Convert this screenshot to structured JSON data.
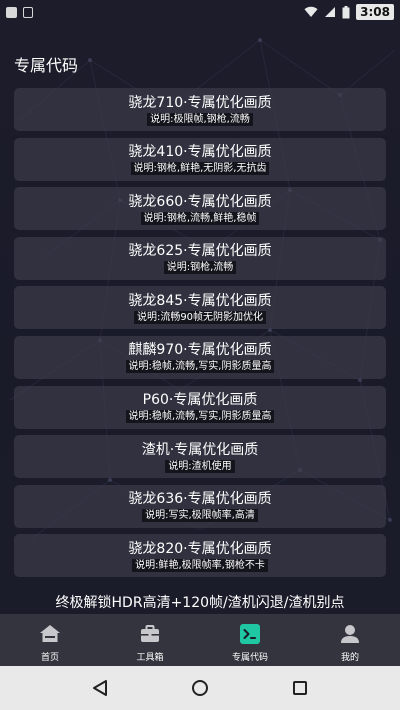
{
  "status_bar": {
    "time": "3:08",
    "icons": [
      "app-notification-icon",
      "sim-notification-icon",
      "wifi-icon",
      "signal-icon",
      "battery-icon"
    ]
  },
  "header": {
    "title": "专属代码"
  },
  "items": [
    {
      "title": "骁龙710·专属优化画质",
      "desc": "说明:极限帧,钢枪,流畅"
    },
    {
      "title": "骁龙410·专属优化画质",
      "desc": "说明:钢枪,鲜艳,无阴影,无抗齿"
    },
    {
      "title": "骁龙660·专属优化画质",
      "desc": "说明:钢枪,流畅,鲜艳,稳帧"
    },
    {
      "title": "骁龙625·专属优化画质",
      "desc": "说明:钢枪,流畅"
    },
    {
      "title": "骁龙845·专属优化画质",
      "desc": "说明:流畅90帧无阴影加优化"
    },
    {
      "title": "麒麟970·专属优化画质",
      "desc": "说明:稳帧,流畅,写实,阴影质量高"
    },
    {
      "title": "P60·专属优化画质",
      "desc": "说明:稳帧,流畅,写实,阴影质量高"
    },
    {
      "title": "渣机·专属优化画质",
      "desc": "说明:渣机使用"
    },
    {
      "title": "骁龙636·专属优化画质",
      "desc": "说明:写实,极限帧率,高清"
    },
    {
      "title": "骁龙820·专属优化画质",
      "desc": "说明:鲜艳,极限帧率,钢枪不卡"
    }
  ],
  "banner": {
    "title": "终极解锁HDR高清+120帧/渣机闪退/渣机别点"
  },
  "bottom_nav": [
    {
      "label": "首页",
      "icon": "home-icon",
      "active": false
    },
    {
      "label": "工具箱",
      "icon": "toolbox-icon",
      "active": false
    },
    {
      "label": "专属代码",
      "icon": "code-terminal-icon",
      "active": true
    },
    {
      "label": "我的",
      "icon": "user-icon",
      "active": false
    }
  ],
  "colors": {
    "background": "#1b1c2a",
    "card": "#3e3e4c",
    "nav_background": "#34343e",
    "active_accent": "#1fc7a3"
  }
}
